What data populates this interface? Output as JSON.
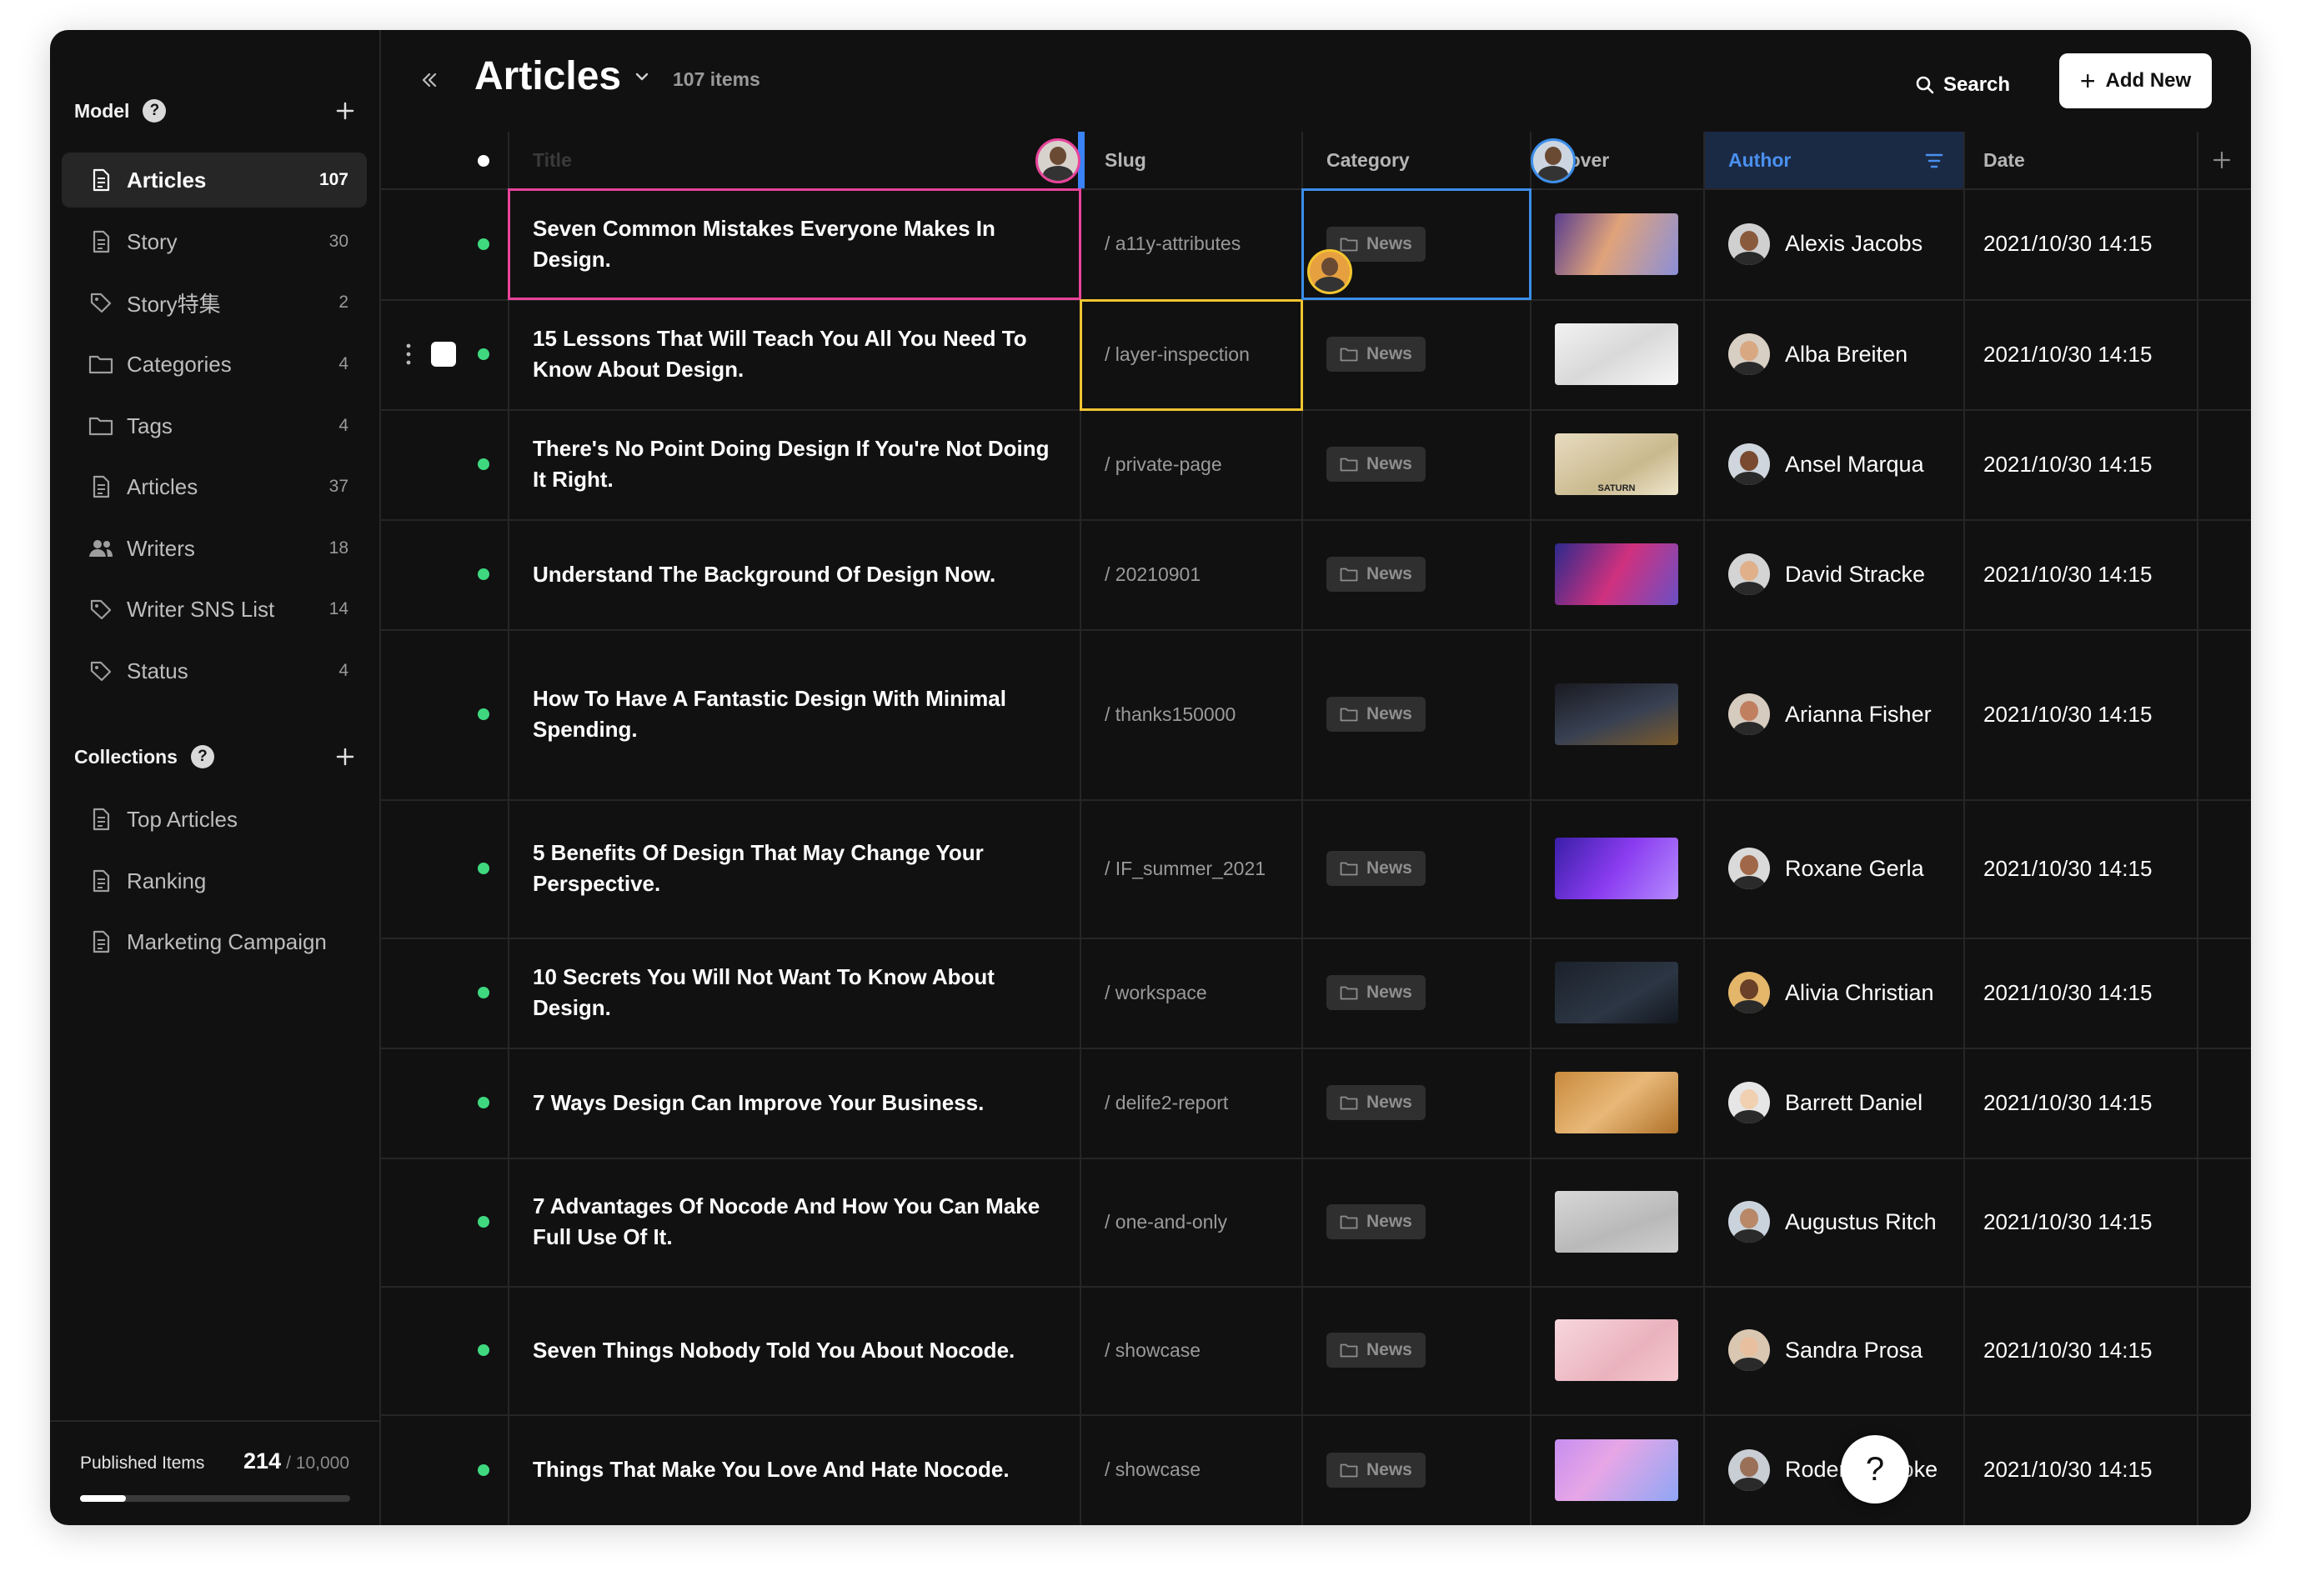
{
  "sidebar": {
    "model_label": "Model",
    "model_items": [
      {
        "label": "Articles",
        "count": "107",
        "icon": "document-icon"
      },
      {
        "label": "Story",
        "count": "30",
        "icon": "document-icon"
      },
      {
        "label": "Story特集",
        "count": "2",
        "icon": "tag-icon"
      },
      {
        "label": "Categories",
        "count": "4",
        "icon": "folder-icon"
      },
      {
        "label": "Tags",
        "count": "4",
        "icon": "folder-icon"
      },
      {
        "label": "Articles",
        "count": "37",
        "icon": "document-icon"
      },
      {
        "label": "Writers",
        "count": "18",
        "icon": "users-icon"
      },
      {
        "label": "Writer SNS List",
        "count": "14",
        "icon": "tag-icon"
      },
      {
        "label": "Status",
        "count": "4",
        "icon": "tag-icon"
      }
    ],
    "collections_label": "Collections",
    "collection_items": [
      {
        "label": "Top Articles",
        "icon": "document-icon"
      },
      {
        "label": "Ranking",
        "icon": "document-icon"
      },
      {
        "label": "Marketing Campaign",
        "icon": "document-icon"
      }
    ],
    "published": {
      "label": "Published Items",
      "count": "214",
      "limit": "/ 10,000",
      "progress": 0.17
    }
  },
  "header": {
    "title": "Articles",
    "item_count": "107 items",
    "search_label": "Search",
    "add_label": "Add New"
  },
  "columns": {
    "title": "Title",
    "slug": "Slug",
    "category": "Category",
    "cover": "Cover",
    "author": "Author",
    "date": "Date"
  },
  "colors": {
    "accent": "#3b82f6",
    "status_published": "#3fd87f",
    "selection_pink": "#e8439a",
    "selection_yellow": "#f3c530",
    "selection_blue": "#3b8eea"
  },
  "rows": [
    {
      "title": "Seven Common Mistakes Everyone Makes In Design.",
      "slug": "a11y-attributes",
      "category": "News",
      "author": "Alexis Jacobs",
      "date": "2021/10/30 14:15"
    },
    {
      "title": "15 Lessons That Will Teach You All You Need To Know About Design.",
      "slug": "layer-inspection",
      "category": "News",
      "author": "Alba Breiten",
      "date": "2021/10/30 14:15"
    },
    {
      "title": "There's No Point Doing Design If You're Not Doing It Right.",
      "slug": "private-page",
      "category": "News",
      "author": "Ansel Marqua",
      "date": "2021/10/30 14:15",
      "cover_text": "SATURN"
    },
    {
      "title": "Understand The Background Of Design Now.",
      "slug": "20210901",
      "category": "News",
      "author": "David Stracke",
      "date": "2021/10/30 14:15"
    },
    {
      "title": "How To Have A Fantastic Design With Minimal Spending.",
      "slug": "thanks150000",
      "category": "News",
      "author": "Arianna Fisher",
      "date": "2021/10/30 14:15"
    },
    {
      "title": "5 Benefits Of Design That May Change Your Perspective.",
      "slug": "IF_summer_2021",
      "category": "News",
      "author": "Roxane Gerla",
      "date": "2021/10/30 14:15"
    },
    {
      "title": "10 Secrets You Will Not Want To Know About Design.",
      "slug": "workspace",
      "category": "News",
      "author": "Alivia Christian",
      "date": "2021/10/30 14:15"
    },
    {
      "title": "7 Ways Design Can Improve Your Business.",
      "slug": "delife2-report",
      "category": "News",
      "author": "Barrett Daniel",
      "date": "2021/10/30 14:15"
    },
    {
      "title": "7 Advantages Of Nocode And How You Can Make Full Use Of It.",
      "slug": "one-and-only",
      "category": "News",
      "author": "Augustus Ritch",
      "date": "2021/10/30 14:15"
    },
    {
      "title": "Seven Things Nobody Told You About Nocode.",
      "slug": "showcase",
      "category": "News",
      "author": "Sandra Prosa",
      "date": "2021/10/30 14:15"
    },
    {
      "title": "Things That Make You Love And Hate Nocode.",
      "slug": "showcase",
      "category": "News",
      "author": "Roderick Stoke",
      "date": "2021/10/30 14:15"
    }
  ],
  "slug_prefix": "/",
  "help_label": "?"
}
